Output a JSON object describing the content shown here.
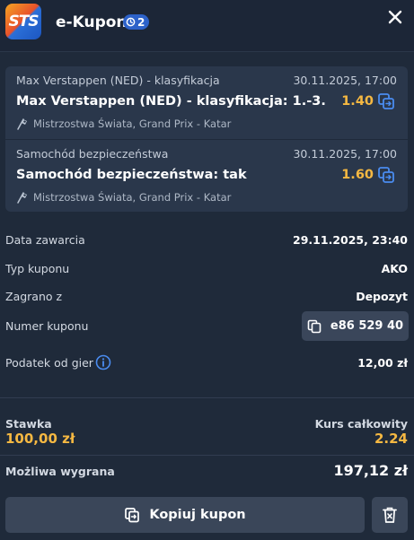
{
  "header": {
    "logo_text": "STS",
    "title": "e-Kupon",
    "badge_count": "2"
  },
  "bets": [
    {
      "market": "Max Verstappen (NED) - klasyfikacja",
      "date": "30.11.2025, 17:00",
      "selection": "Max Verstappen (NED) - klasyfikacja: 1.-3.",
      "odds": "1.40",
      "event": "Mistrzostwa Świata, Grand Prix - Katar"
    },
    {
      "market": "Samochód bezpieczeństwa",
      "date": "30.11.2025, 17:00",
      "selection": "Samochód bezpieczeństwa: tak",
      "odds": "1.60",
      "event": "Mistrzostwa Świata, Grand Prix - Katar"
    }
  ],
  "details": {
    "placed_label": "Data zawarcia",
    "placed_value": "29.11.2025, 23:40",
    "type_label": "Typ kuponu",
    "type_value": "AKO",
    "source_label": "Zagrano z",
    "source_value": "Depozyt",
    "number_label": "Numer kuponu",
    "number_value": "e86 529 40",
    "tax_label": "Podatek od gier",
    "tax_value": "12,00 zł"
  },
  "summary": {
    "stake_label": "Stawka",
    "stake_value": "100,00 zł",
    "total_odds_label": "Kurs całkowity",
    "total_odds_value": "2.24",
    "win_label": "Możliwa wygrana",
    "win_value": "197,12 zł"
  },
  "actions": {
    "copy_label": "Kopiuj kupon"
  },
  "colors": {
    "background": "#1f2a3a",
    "card": "#2a374b",
    "accent_odds": "#f5b842",
    "badge": "#2d62c9"
  }
}
